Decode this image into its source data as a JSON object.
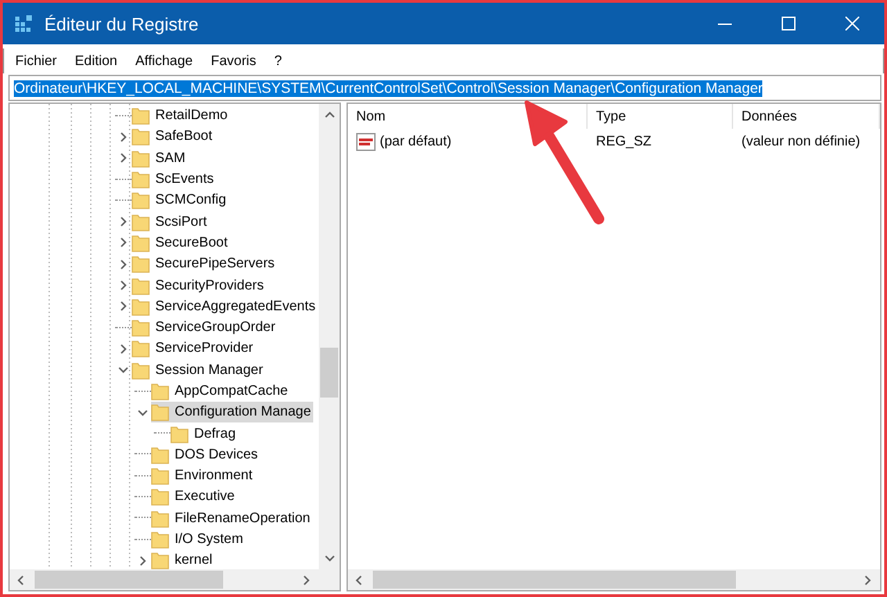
{
  "window": {
    "title": "Éditeur du Registre"
  },
  "menu": [
    "Fichier",
    "Edition",
    "Affichage",
    "Favoris",
    "?"
  ],
  "address": {
    "value": "Ordinateur\\HKEY_LOCAL_MACHINE\\SYSTEM\\CurrentControlSet\\Control\\Session Manager\\Configuration Manager",
    "selected": true
  },
  "tree": [
    {
      "label": "RetailDemo",
      "expandable": false,
      "expanded": false,
      "selected": false
    },
    {
      "label": "SafeBoot",
      "expandable": true,
      "expanded": false,
      "selected": false
    },
    {
      "label": "SAM",
      "expandable": true,
      "expanded": false,
      "selected": false
    },
    {
      "label": "ScEvents",
      "expandable": false,
      "expanded": false,
      "selected": false
    },
    {
      "label": "SCMConfig",
      "expandable": false,
      "expanded": false,
      "selected": false
    },
    {
      "label": "ScsiPort",
      "expandable": true,
      "expanded": false,
      "selected": false
    },
    {
      "label": "SecureBoot",
      "expandable": true,
      "expanded": false,
      "selected": false
    },
    {
      "label": "SecurePipeServers",
      "expandable": true,
      "expanded": false,
      "selected": false
    },
    {
      "label": "SecurityProviders",
      "expandable": true,
      "expanded": false,
      "selected": false
    },
    {
      "label": "ServiceAggregatedEvents",
      "expandable": true,
      "expanded": false,
      "selected": false
    },
    {
      "label": "ServiceGroupOrder",
      "expandable": false,
      "expanded": false,
      "selected": false
    },
    {
      "label": "ServiceProvider",
      "expandable": true,
      "expanded": false,
      "selected": false
    },
    {
      "label": "Session Manager",
      "expanded": true,
      "selected": false,
      "children": [
        {
          "label": "AppCompatCache",
          "expandable": false,
          "expanded": false,
          "selected": false
        },
        {
          "label": "Configuration Manage",
          "expanded": true,
          "selected": true,
          "children": [
            {
              "label": "Defrag",
              "expandable": false,
              "expanded": false,
              "selected": false
            }
          ]
        },
        {
          "label": "DOS Devices",
          "expandable": false,
          "expanded": false,
          "selected": false
        },
        {
          "label": "Environment",
          "expandable": false,
          "expanded": false,
          "selected": false
        },
        {
          "label": "Executive",
          "expandable": false,
          "expanded": false,
          "selected": false
        },
        {
          "label": "FileRenameOperation",
          "expandable": false,
          "expanded": false,
          "selected": false
        },
        {
          "label": "I/O System",
          "expandable": false,
          "expanded": false,
          "selected": false
        },
        {
          "label": "kernel",
          "expandable": true,
          "expanded": false,
          "selected": false
        }
      ]
    }
  ],
  "values": {
    "columns": [
      "Nom",
      "Type",
      "Données"
    ],
    "rows": [
      {
        "name": "(par défaut)",
        "type": "REG_SZ",
        "data": "(valeur non définie)"
      }
    ]
  }
}
